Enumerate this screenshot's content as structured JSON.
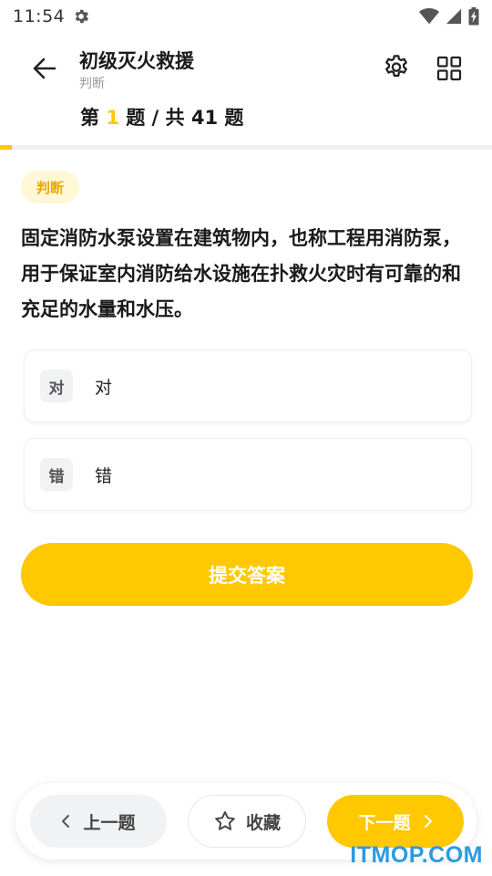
{
  "status_bar": {
    "time": "11:54",
    "icons": [
      "gear-icon",
      "wifi-icon",
      "signal-icon",
      "battery-charging-icon"
    ]
  },
  "header": {
    "title": "初级灭火救援",
    "subtitle": "判断",
    "progress": {
      "prefix": "第 ",
      "current": "1",
      "suffix": " 题 / 共 41 题",
      "current_value": 1,
      "total_value": 41
    },
    "icons": {
      "back": "arrow-left-icon",
      "settings": "gear-icon",
      "grid": "grid-icon"
    }
  },
  "question": {
    "type_tag": "判断",
    "text": "固定消防水泵设置在建筑物内，也称工程用消防泵，用于保证室内消防给水设施在扑救火灾时有可靠的和充足的水量和水压。",
    "options": [
      {
        "key": "对",
        "label": "对"
      },
      {
        "key": "错",
        "label": "错"
      }
    ]
  },
  "submit_label": "提交答案",
  "bottom_bar": {
    "prev_label": "上一题",
    "favorite_label": "收藏",
    "next_label": "下一题",
    "icons": {
      "prev": "chevron-left-icon",
      "favorite": "star-icon",
      "next": "chevron-right-icon"
    }
  },
  "watermark": "ITMOP.COM",
  "colors": {
    "accent": "#ffc800",
    "tag_background": "#fff7d6",
    "tag_text": "#f0a800",
    "watermark": "#2a9ce0"
  }
}
